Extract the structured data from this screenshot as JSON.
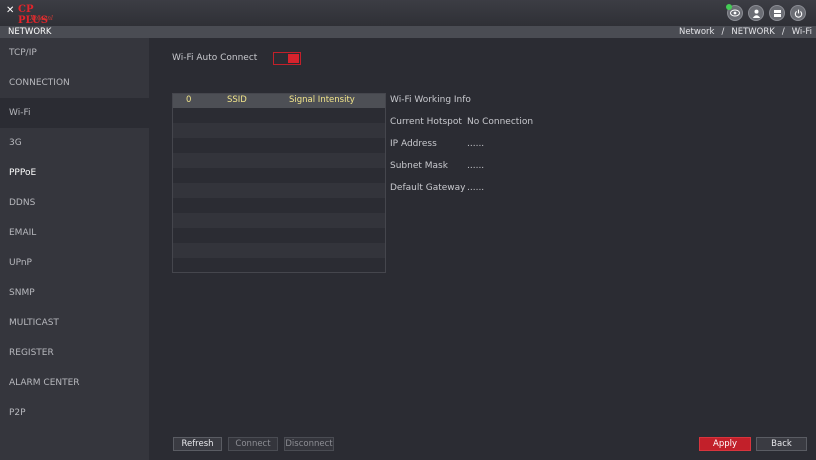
{
  "header": {
    "logo_mark": "✕",
    "logo_text": "CP PLUS",
    "logo_sub": "Xmaanl",
    "icons": [
      "eye-icon",
      "user-icon",
      "storage-icon",
      "power-icon"
    ]
  },
  "title_strip": {
    "title": "NETWORK",
    "breadcrumb": [
      "Network",
      "NETWORK",
      "Wi-Fi"
    ],
    "separator": "/"
  },
  "sidebar": {
    "items": [
      {
        "label": "TCP/IP"
      },
      {
        "label": "CONNECTION"
      },
      {
        "label": "Wi-Fi",
        "active": true
      },
      {
        "label": "3G"
      },
      {
        "label": "PPPoE"
      },
      {
        "label": "DDNS"
      },
      {
        "label": "EMAIL"
      },
      {
        "label": "UPnP"
      },
      {
        "label": "SNMP"
      },
      {
        "label": "MULTICAST"
      },
      {
        "label": "REGISTER"
      },
      {
        "label": "ALARM CENTER"
      },
      {
        "label": "P2P"
      }
    ]
  },
  "wifi": {
    "auto_connect_label": "Wi-Fi Auto Connect",
    "auto_connect_on": true,
    "table": {
      "headers": [
        "0",
        "SSID",
        "Signal Intensity"
      ],
      "rows": []
    },
    "info": {
      "title": "Wi-Fi Working Info",
      "current_hotspot_label": "Current Hotspot",
      "current_hotspot_value": "No Connection",
      "ip_label": "IP Address",
      "ip_value": "......",
      "subnet_label": "Subnet Mask",
      "subnet_value": "......",
      "gateway_label": "Default Gateway",
      "gateway_value": "......"
    }
  },
  "buttons": {
    "refresh": "Refresh",
    "connect": "Connect",
    "disconnect": "Disconnect",
    "apply": "Apply",
    "back": "Back"
  },
  "colors": {
    "accent": "#c2202a",
    "header_text": "#f2e58a",
    "status_dot": "#44cc55"
  }
}
